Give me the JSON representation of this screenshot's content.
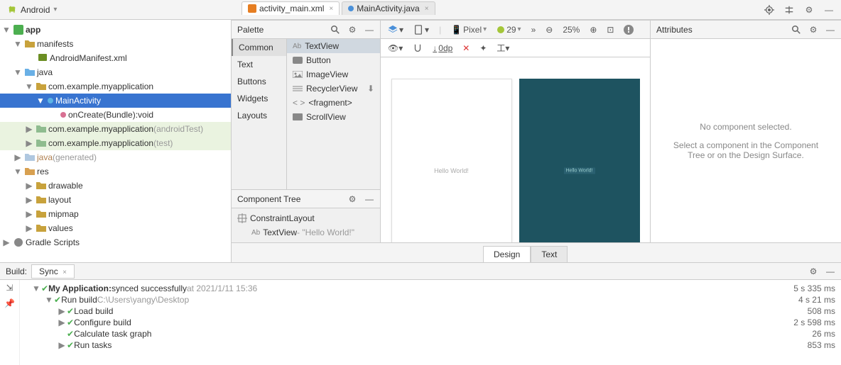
{
  "topbar": {
    "selector": "Android"
  },
  "tabs": {
    "t1": "activity_main.xml",
    "t2": "MainActivity.java"
  },
  "tree": {
    "app": "app",
    "manifests": "manifests",
    "manifest_file": "AndroidManifest.xml",
    "java": "java",
    "pkg": "com.example.myapplication",
    "main_activity": "MainActivity",
    "on_create": "onCreate(Bundle):void",
    "pkg_android_test": "com.example.myapplication",
    "android_test_suffix": " (androidTest)",
    "pkg_test": "com.example.myapplication",
    "test_suffix": " (test)",
    "java_gen": "java",
    "gen_suffix": " (generated)",
    "res": "res",
    "drawable": "drawable",
    "layout": "layout",
    "mipmap": "mipmap",
    "values": "values",
    "gradle": "Gradle Scripts"
  },
  "palette": {
    "title": "Palette",
    "cats": [
      "Common",
      "Text",
      "Buttons",
      "Widgets",
      "Layouts"
    ],
    "items": [
      "TextView",
      "Button",
      "ImageView",
      "RecyclerView",
      "<fragment>",
      "ScrollView"
    ]
  },
  "component_tree": {
    "title": "Component Tree",
    "root": "ConstraintLayout",
    "child": "TextView",
    "child_suffix": "- \"Hello World!\""
  },
  "design_tb": {
    "device": "Pixel",
    "api": "29",
    "zoom": "25%",
    "margin": "0dp"
  },
  "preview": {
    "hello": "Hello World!"
  },
  "attributes": {
    "title": "Attributes",
    "msg1": "No component selected.",
    "msg2": "Select a component in the Component Tree or on the Design Surface."
  },
  "design_tabs": {
    "design": "Design",
    "text": "Text"
  },
  "build": {
    "label": "Build:",
    "tab": "Sync",
    "rows": [
      {
        "indent": 0,
        "tw": "▼",
        "chk": true,
        "bold": true,
        "text": "My Application:",
        "suffix": " synced successfully",
        "gray": " at 2021/1/11 15:36",
        "time": "5 s 335 ms"
      },
      {
        "indent": 1,
        "tw": "▼",
        "chk": true,
        "text": "Run build",
        "gray": " C:\\Users\\yangy\\Desktop",
        "time": "4 s 21 ms"
      },
      {
        "indent": 2,
        "tw": "▶",
        "chk": true,
        "text": "Load build",
        "time": "508 ms"
      },
      {
        "indent": 2,
        "tw": "▶",
        "chk": true,
        "text": "Configure build",
        "time": "2 s 598 ms"
      },
      {
        "indent": 2,
        "tw": "",
        "chk": true,
        "text": "Calculate task graph",
        "time": "26 ms"
      },
      {
        "indent": 2,
        "tw": "▶",
        "chk": true,
        "text": "Run tasks",
        "time": "853 ms"
      }
    ]
  }
}
